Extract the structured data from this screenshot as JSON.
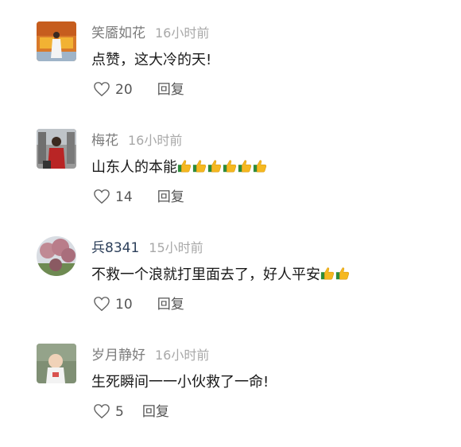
{
  "comments": [
    {
      "username": "笑靥如花",
      "time": "16小时前",
      "text": "点赞，这大冷的天!",
      "thumbs": 0,
      "likes": "20",
      "reply_label": "回复"
    },
    {
      "username": "梅花",
      "time": "16小时前",
      "text": "山东人的本能",
      "thumbs": 6,
      "likes": "14",
      "reply_label": "回复"
    },
    {
      "username": "兵8341",
      "time": "15小时前",
      "text": "不救一个浪就打里面去了，好人平安",
      "thumbs": 2,
      "likes": "10",
      "reply_label": "回复"
    },
    {
      "username": "岁月静好",
      "time": "16小时前",
      "text": "生死瞬间一一小伙救了一命!",
      "thumbs": 0,
      "likes": "5",
      "reply_label": "回复"
    }
  ],
  "icons": {
    "like": "heart-outline-icon",
    "thumbs": "thumbs-up-emoji-icon"
  },
  "colors": {
    "username": "#7c7c7c",
    "username_highlight": "#2c3f5a",
    "time": "#a8a8a8",
    "text": "#1a1a1a",
    "action": "#555555"
  }
}
